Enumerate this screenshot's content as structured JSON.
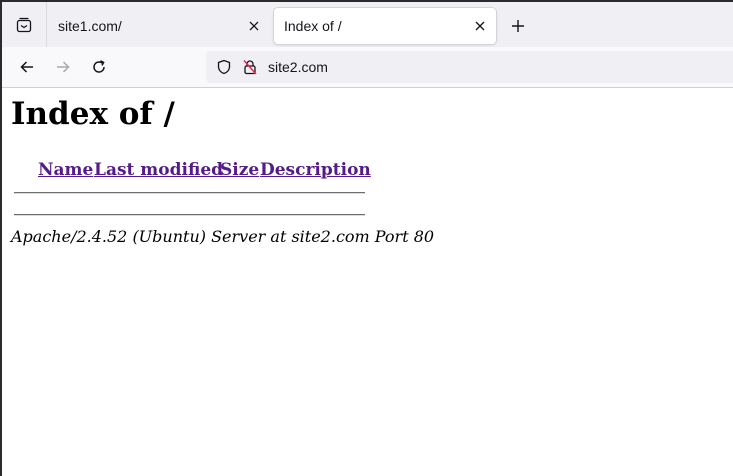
{
  "browser": {
    "tabs": [
      {
        "title": "site1.com/",
        "active": false
      },
      {
        "title": "Index of /",
        "active": true
      }
    ],
    "address": "site2.com"
  },
  "page": {
    "heading": "Index of /",
    "columns": [
      "Name",
      "Last modified",
      "Size",
      "Description"
    ],
    "address_line": "Apache/2.4.52 (Ubuntu) Server at site2.com Port 80"
  },
  "colors": {
    "link_visited": "#551a8b",
    "tabstrip_bg": "#f0f0f4",
    "urlbar_bg": "#f0f0f4"
  },
  "icons": [
    "tab-list-icon",
    "close-icon",
    "plus-icon",
    "back-arrow-icon",
    "forward-arrow-icon",
    "reload-icon",
    "shield-icon",
    "insecure-lock-icon"
  ]
}
